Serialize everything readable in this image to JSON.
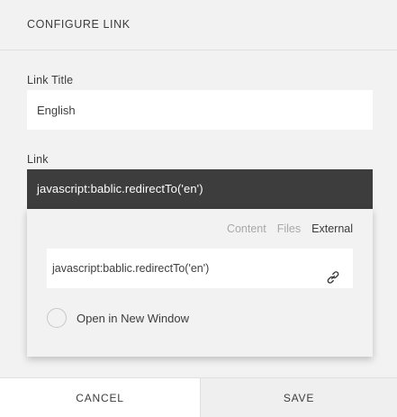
{
  "header": {
    "title": "CONFIGURE LINK"
  },
  "form": {
    "link_title_label": "Link Title",
    "link_title_value": "English",
    "link_label": "Link",
    "link_value": "javascript:bablic.redirectTo('en')"
  },
  "popover": {
    "tabs": [
      {
        "label": "Content",
        "active": false
      },
      {
        "label": "Files",
        "active": false
      },
      {
        "label": "External",
        "active": true
      }
    ],
    "url_value": "javascript:bablic.redirectTo('en')",
    "url_icon": "link-chain-icon",
    "new_window_label": "Open in New Window",
    "new_window_checked": false
  },
  "footer": {
    "cancel_label": "CANCEL",
    "save_label": "SAVE"
  },
  "colors": {
    "background": "#f2f2f2",
    "input_dark": "#3d3d3d",
    "tab_inactive": "#a9a9a9",
    "text": "#3c3c3c"
  }
}
